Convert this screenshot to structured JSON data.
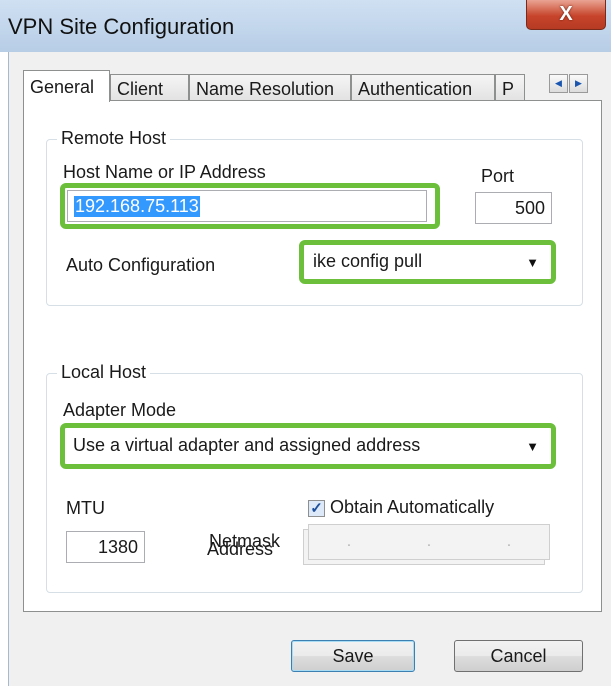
{
  "window": {
    "title": "VPN Site Configuration",
    "close_label": "X"
  },
  "tabs": [
    {
      "label": "General",
      "active": true
    },
    {
      "label": "Client",
      "active": false
    },
    {
      "label": "Name Resolution",
      "active": false
    },
    {
      "label": "Authentication",
      "active": false
    },
    {
      "label": "P",
      "active": false
    }
  ],
  "tab_scroll": {
    "left": "◀",
    "right": "▶"
  },
  "remote_host": {
    "legend": "Remote Host",
    "host_label": "Host Name or IP Address",
    "host_value": "192.168.75.113",
    "port_label": "Port",
    "port_value": "500",
    "auto_config_label": "Auto Configuration",
    "auto_config_value": "ike config pull"
  },
  "local_host": {
    "legend": "Local Host",
    "adapter_mode_label": "Adapter Mode",
    "adapter_mode_value": "Use a virtual adapter and assigned address",
    "mtu_label": "MTU",
    "mtu_value": "1380",
    "obtain_auto_label": "Obtain Automatically",
    "obtain_auto_checked": true,
    "address_label": "Address",
    "netmask_label": "Netmask",
    "ip_dot": "."
  },
  "buttons": {
    "save": "Save",
    "cancel": "Cancel"
  },
  "icons": {
    "dropdown_arrow": "▼",
    "check": "✓"
  },
  "colors": {
    "highlight": "#6bbf3a",
    "selection": "#3399ff",
    "close": "#c7442b"
  }
}
